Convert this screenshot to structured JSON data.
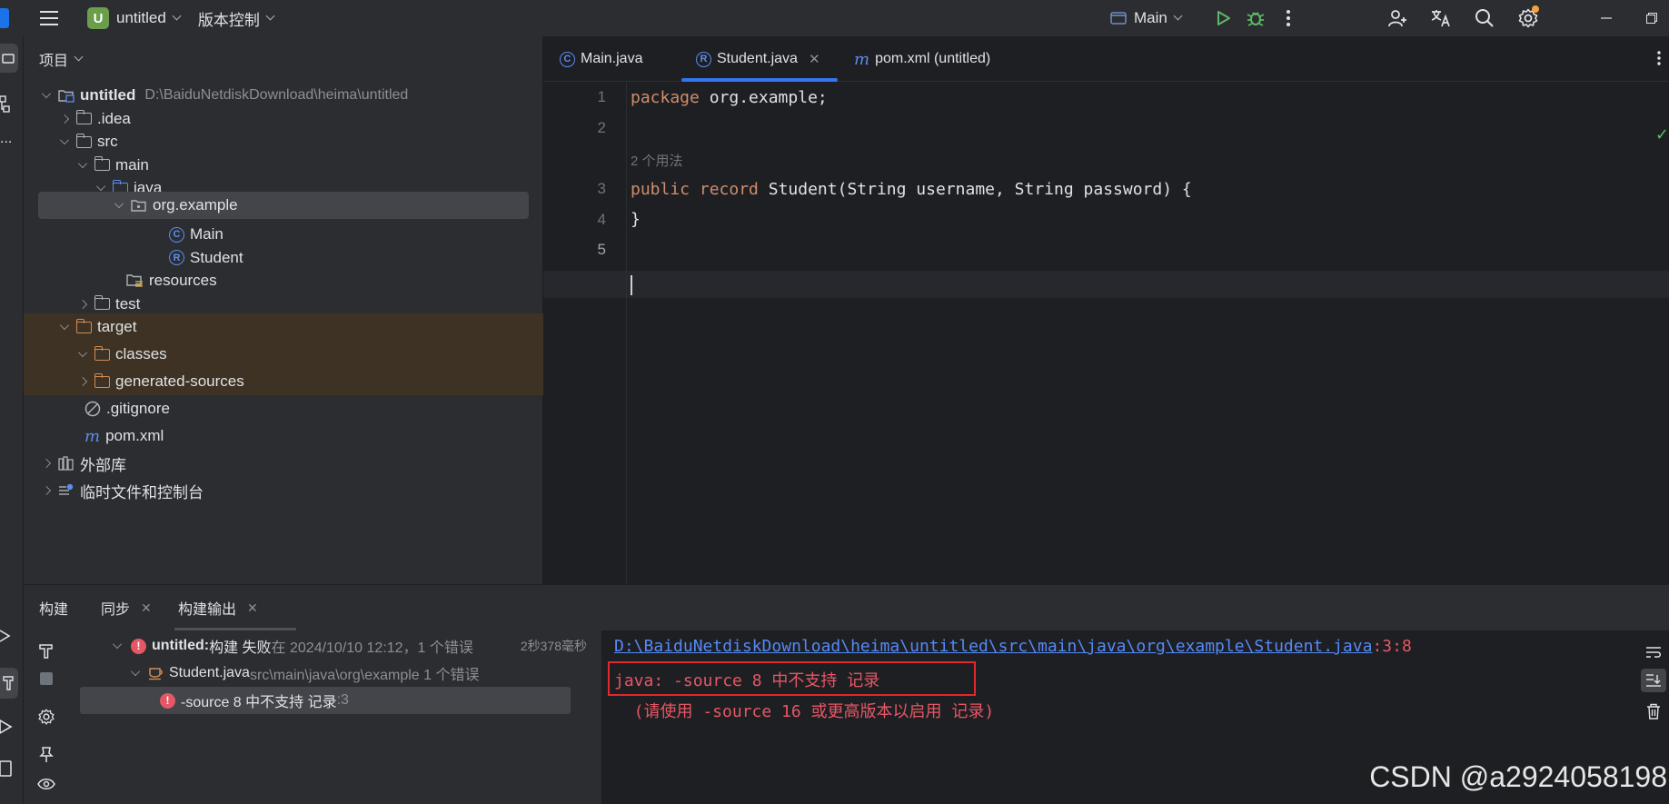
{
  "titlebar": {
    "project_badge": "U",
    "project_name": "untitled",
    "vcs_menu": "版本控制",
    "run_config": "Main"
  },
  "project_panel": {
    "title": "项目",
    "tree": [
      {
        "label": "untitled",
        "path": "D:\\BaiduNetdiskDownload\\heima\\untitled",
        "icon": "module-folder-icon",
        "expanded": true
      },
      {
        "label": ".idea",
        "icon": "folder-icon",
        "expanded": false
      },
      {
        "label": "src",
        "icon": "folder-icon",
        "expanded": true
      },
      {
        "label": "main",
        "icon": "folder-icon",
        "expanded": true
      },
      {
        "label": "java",
        "icon": "source-folder-icon",
        "expanded": true
      },
      {
        "label": "org.example",
        "icon": "package-icon",
        "expanded": true,
        "selected": true
      },
      {
        "label": "Main",
        "icon": "class-icon"
      },
      {
        "label": "Student",
        "icon": "record-icon"
      },
      {
        "label": "resources",
        "icon": "resources-folder-icon"
      },
      {
        "label": "test",
        "icon": "folder-icon",
        "expanded": false
      },
      {
        "label": "target",
        "icon": "excluded-folder-icon",
        "expanded": true
      },
      {
        "label": "classes",
        "icon": "excluded-folder-icon",
        "expanded": true
      },
      {
        "label": "generated-sources",
        "icon": "excluded-folder-icon",
        "expanded": false
      },
      {
        "label": ".gitignore",
        "icon": "ignore-file-icon"
      },
      {
        "label": "pom.xml",
        "icon": "maven-file-icon"
      },
      {
        "label": "外部库",
        "icon": "library-icon",
        "expanded": false
      },
      {
        "label": "临时文件和控制台",
        "icon": "scratch-icon",
        "expanded": false
      }
    ]
  },
  "editor": {
    "tabs": [
      {
        "label": "Main.java",
        "icon": "class-icon"
      },
      {
        "label": "Student.java",
        "icon": "record-icon",
        "active": true
      },
      {
        "label": "pom.xml (untitled)",
        "icon": "maven-file-icon"
      }
    ],
    "lines": {
      "l1": "1",
      "l2": "2",
      "l3": "3",
      "l4": "4",
      "l5": "5"
    },
    "code": {
      "line1_kw": "package",
      "line1_rest": " org.example;",
      "usage_hint": "2 个用法",
      "line3_kw1": "public",
      "line3_kw2": "record",
      "line3_rest": " Student(String username, String password) {",
      "line4": "}"
    }
  },
  "bottom_panel": {
    "tabs": [
      {
        "label": "构建"
      },
      {
        "label": "同步"
      },
      {
        "label": "构建输出",
        "active": true
      }
    ],
    "build_tree": {
      "root_name": "untitled:",
      "root_status": " 构建 失败",
      "root_detail": " 在 2024/10/10 12:12，1 个错误",
      "root_time": "2秒378毫秒",
      "file_name": "Student.java",
      "file_path": " src\\main\\java\\org\\example 1 个错误",
      "error_msg": "-source 8 中不支持 记录",
      "error_loc": " :3"
    },
    "output": {
      "link": "D:\\BaiduNetdiskDownload\\heima\\untitled\\src\\main\\java\\org\\example\\Student.java",
      "link_pos": ":3:8",
      "error_line": "java: -source 8 中不支持 记录",
      "hint_line": "  (请使用 -source 16 或更高版本以启用 记录)"
    },
    "watermark": "CSDN @a2924058198"
  },
  "colors": {
    "background": "#1e1f22",
    "panel": "#2b2d30",
    "accent": "#3574f0",
    "keyword": "#cf8e6d",
    "error": "#e55765",
    "link": "#548af7"
  }
}
